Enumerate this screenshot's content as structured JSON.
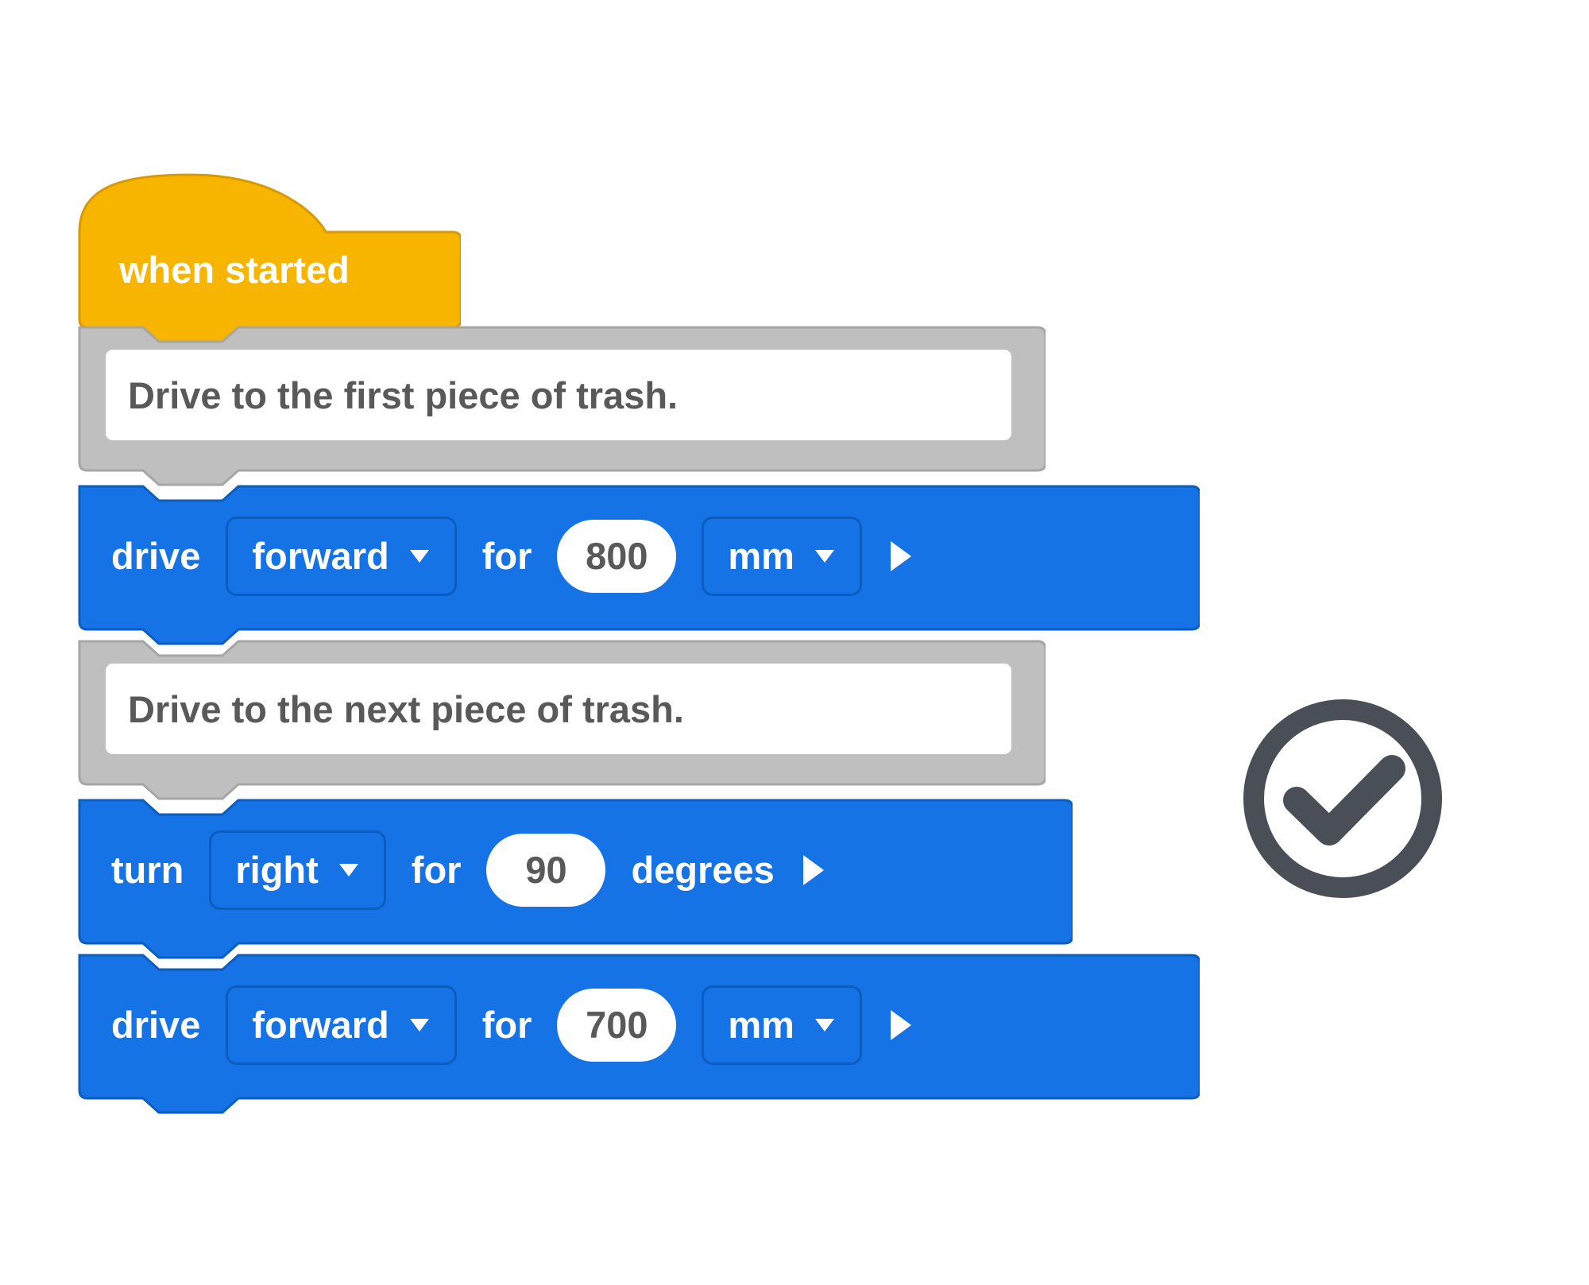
{
  "hat": {
    "label": "when started"
  },
  "blocks": {
    "comment1": {
      "text": "Drive to the first piece of trash."
    },
    "drive1": {
      "cmd": "drive",
      "direction": "forward",
      "for_label": "for",
      "value": "800",
      "unit": "mm"
    },
    "comment2": {
      "text": "Drive to the next piece of trash."
    },
    "turn1": {
      "cmd": "turn",
      "direction": "right",
      "for_label": "for",
      "value": "90",
      "unit_label": "degrees"
    },
    "drive2": {
      "cmd": "drive",
      "direction": "forward",
      "for_label": "for",
      "value": "700",
      "unit": "mm"
    }
  },
  "colors": {
    "hat_fill": "#f7b500",
    "hat_stroke": "#d99a00",
    "comment_fill": "#bfbfbf",
    "comment_stroke": "#a6a6a6",
    "cmd_fill": "#1673e6",
    "cmd_stroke": "#0b5dbf",
    "check": "#4a4e57"
  }
}
